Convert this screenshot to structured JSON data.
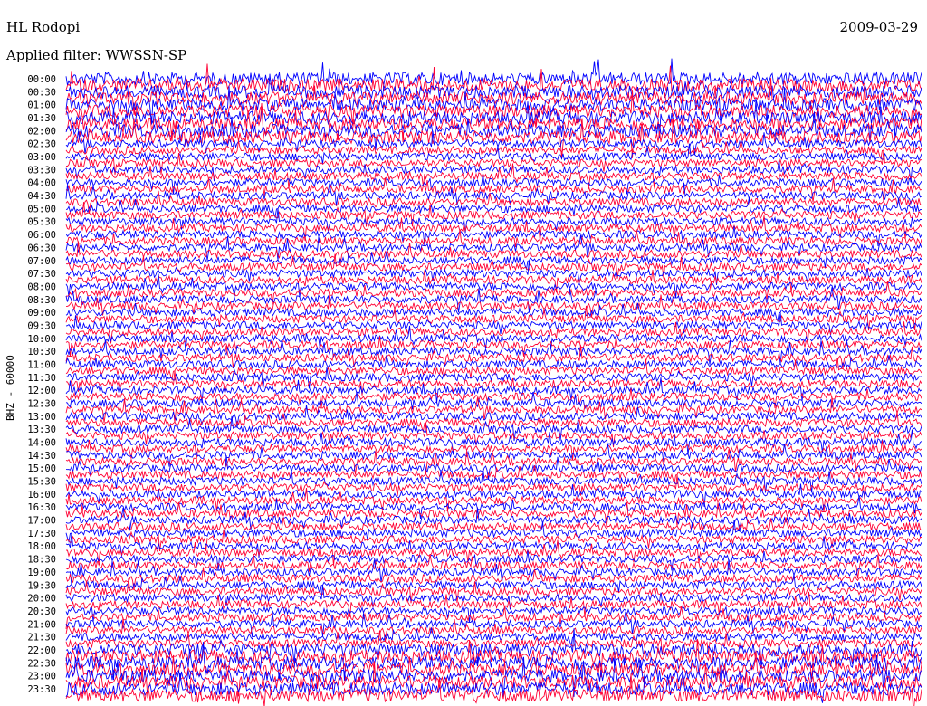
{
  "header": {
    "station": "HL Rodopi",
    "date": "2009-03-29",
    "filter_text": "Applied filter: WWSSN-SP"
  },
  "chart_data": {
    "type": "helicorder",
    "title": "HL Rodopi",
    "date": "2009-03-29",
    "filter": "WWSSN-SP",
    "ylabel": "BHZ - 60000",
    "trace_interval_minutes": 15,
    "tick_labels": [
      "00:00",
      "00:30",
      "01:00",
      "01:30",
      "02:00",
      "02:30",
      "03:00",
      "03:30",
      "04:00",
      "04:30",
      "05:00",
      "05:30",
      "06:00",
      "06:30",
      "07:00",
      "07:30",
      "08:00",
      "08:30",
      "09:00",
      "09:30",
      "10:00",
      "10:30",
      "11:00",
      "11:30",
      "12:00",
      "12:30",
      "13:00",
      "13:30",
      "14:00",
      "14:30",
      "15:00",
      "15:30",
      "16:00",
      "16:30",
      "17:00",
      "17:30",
      "18:00",
      "18:30",
      "19:00",
      "19:30",
      "20:00",
      "20:30",
      "21:00",
      "21:30",
      "22:00",
      "22:30",
      "23:00",
      "23:30"
    ],
    "trace_count": 96,
    "trace_colors": [
      "#0000ff",
      "#ff0033"
    ],
    "colors": {
      "trace_a": "#0000ff",
      "trace_b": "#ff0033",
      "background": "#ffffff",
      "text": "#000000"
    },
    "noise_level_by_trace_group": [
      {
        "from": "00:00",
        "to": "02:00",
        "level": "high"
      },
      {
        "from": "02:30",
        "to": "21:45",
        "level": "moderate"
      },
      {
        "from": "22:00",
        "to": "23:45",
        "level": "high"
      }
    ],
    "grid": false
  }
}
